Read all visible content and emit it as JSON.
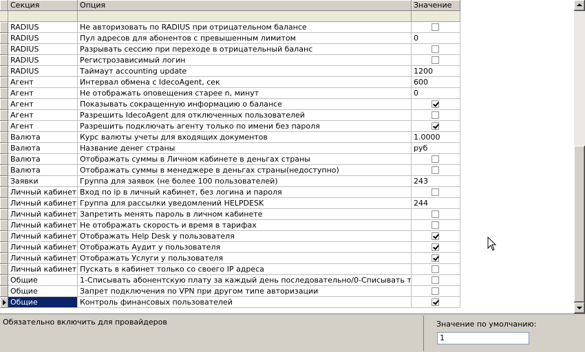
{
  "columns": {
    "section": "Секция",
    "option": "Опция",
    "value": "Значение"
  },
  "rows": [
    {
      "section": "RADIUS",
      "option": "Не авторизовать по RADIUS при отрицательном балансе",
      "type": "checkbox",
      "checked": false,
      "value": ""
    },
    {
      "section": "RADIUS",
      "option": "Пул адресов для абонентов с превышенным лимитом",
      "type": "text",
      "checked": false,
      "value": "0"
    },
    {
      "section": "RADIUS",
      "option": "Разрывать сессию при переходе в отрицательный баланс",
      "type": "checkbox",
      "checked": false,
      "value": ""
    },
    {
      "section": "RADIUS",
      "option": "Регистрозависимый логин",
      "type": "checkbox",
      "checked": false,
      "value": ""
    },
    {
      "section": "RADIUS",
      "option": "Таймаут accounting update",
      "type": "text",
      "checked": false,
      "value": "1200"
    },
    {
      "section": "Агент",
      "option": "Интервал обмена с IdecoAgent, сек",
      "type": "text",
      "checked": false,
      "value": "600"
    },
    {
      "section": "Агент",
      "option": "Не отображать оповещения старее n, минут",
      "type": "text",
      "checked": false,
      "value": "0"
    },
    {
      "section": "Агент",
      "option": "Показывать сокращенную информацию о балансе",
      "type": "checkbox",
      "checked": true,
      "value": ""
    },
    {
      "section": "Агент",
      "option": "Разрешить IdecoAgent для отключенных пользователей",
      "type": "checkbox",
      "checked": false,
      "value": ""
    },
    {
      "section": "Агент",
      "option": "Разрешить подключать агенту только по имени без пароля",
      "type": "checkbox",
      "checked": true,
      "value": ""
    },
    {
      "section": "Валюта",
      "option": "Курс валюты учеты для входящих документов",
      "type": "text",
      "checked": false,
      "value": "1.0000"
    },
    {
      "section": "Валюта",
      "option": "Название денег страны",
      "type": "text",
      "checked": false,
      "value": "руб"
    },
    {
      "section": "Валюта",
      "option": "Отображать суммы в Личном кабинете в деньгах страны",
      "type": "checkbox",
      "checked": false,
      "value": ""
    },
    {
      "section": "Валюта",
      "option": "Отображать суммы в менеджере в деньгах страны(недоступно)",
      "type": "checkbox",
      "checked": false,
      "value": ""
    },
    {
      "section": "Заявки",
      "option": "Группа для заявок (не более 100 пользователей)",
      "type": "text",
      "checked": false,
      "value": "243"
    },
    {
      "section": "Личный кабинет",
      "option": "Вход по ip в личный кабинет, без логина и пароля",
      "type": "checkbox",
      "checked": false,
      "value": ""
    },
    {
      "section": "Личный кабинет",
      "option": "Группа для рассылки уведомлений HELPDESK",
      "type": "text",
      "checked": false,
      "value": "244"
    },
    {
      "section": "Личный кабинет",
      "option": "Запретить менять пароль в личном кабинете",
      "type": "checkbox",
      "checked": false,
      "value": ""
    },
    {
      "section": "Личный кабинет",
      "option": "Не отображать скорость и время в тарифах",
      "type": "checkbox",
      "checked": false,
      "value": ""
    },
    {
      "section": "Личный кабинет",
      "option": "Отображать Help Desk у пользователя",
      "type": "checkbox",
      "checked": true,
      "value": ""
    },
    {
      "section": "Личный кабинет",
      "option": "Отображать Аудит у пользователя",
      "type": "checkbox",
      "checked": true,
      "value": ""
    },
    {
      "section": "Личный кабинет",
      "option": "Отображать Услуги у пользователя",
      "type": "checkbox",
      "checked": true,
      "value": ""
    },
    {
      "section": "Личный кабинет",
      "option": "Пускать в кабинет только со своего IP адреса",
      "type": "checkbox",
      "checked": false,
      "value": ""
    },
    {
      "section": "Общие",
      "option": "1-Списывать абонентскую плату за каждый день последовательно/0-Списывать только за посл",
      "type": "checkbox",
      "checked": false,
      "value": ""
    },
    {
      "section": "Общие",
      "option": "Запрет подключения по VPN при другом типе авторизации",
      "type": "checkbox",
      "checked": false,
      "value": ""
    },
    {
      "section": "Общие",
      "option": "Контроль финансовых пользователей",
      "type": "checkbox",
      "checked": true,
      "value": "",
      "active": true
    }
  ],
  "description": "Обязательно включить для провайдеров",
  "default_value": {
    "label": "Значение по умолчанию:",
    "value": "1"
  },
  "colors": {
    "selection": "#0a246a",
    "panel": "#d4d0c8"
  }
}
